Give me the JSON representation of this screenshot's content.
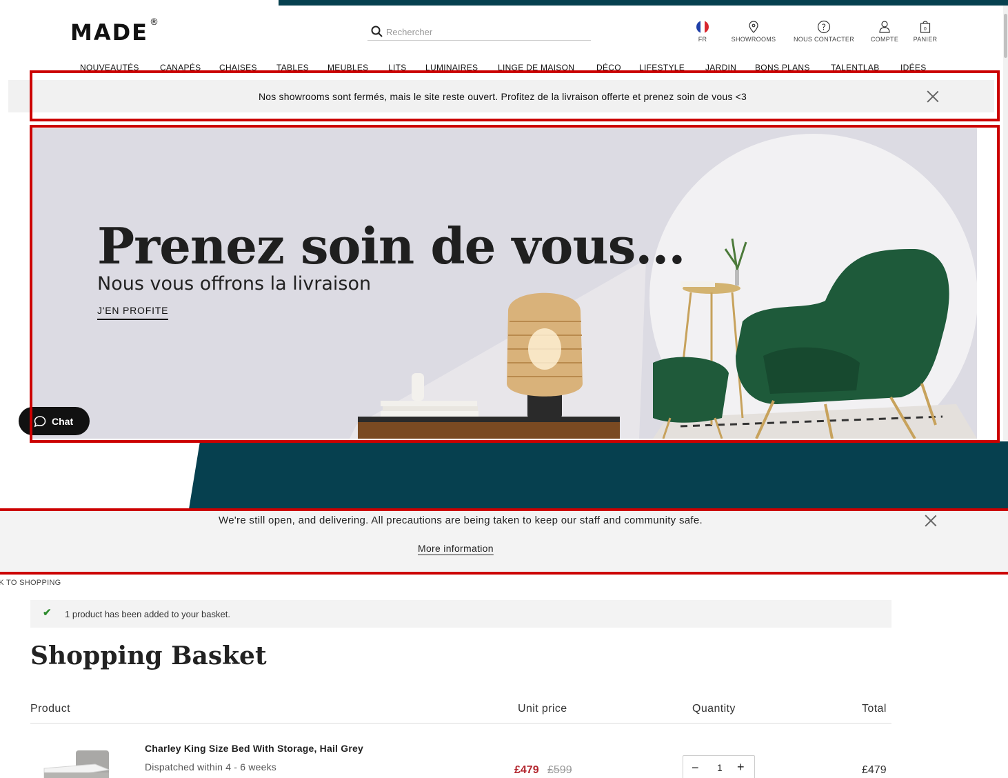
{
  "header": {
    "logo": "MADE",
    "logo_mark": "®",
    "search_placeholder": "Rechercher",
    "utils": [
      {
        "icon": "france-flag-icon",
        "label": "FR"
      },
      {
        "icon": "location-pin-icon",
        "label": "SHOWROOMS"
      },
      {
        "icon": "help-circle-icon",
        "label": "NOUS CONTACTER"
      },
      {
        "icon": "user-icon",
        "label": "COMPTE"
      },
      {
        "icon": "basket-icon",
        "label": "PANIER",
        "count": "0"
      }
    ],
    "nav": [
      "NOUVEAUTÉS",
      "CANAPÉS",
      "CHAISES",
      "TABLES",
      "MEUBLES",
      "LITS",
      "LUMINAIRES",
      "LINGE DE MAISON",
      "DÉCO",
      "LIFESTYLE",
      "JARDIN",
      "BONS PLANS",
      "TALENTLAB",
      "IDÉES"
    ]
  },
  "fr_banner": {
    "text": "Nos showrooms sont fermés, mais le site reste ouvert. Profitez de la livraison offerte et prenez soin de vous <3"
  },
  "hero": {
    "title": "Prenez soin de vous...",
    "subtitle": "Nous vous offrons la livraison",
    "cta": "J'EN PROFITE"
  },
  "chat": {
    "label": "Chat"
  },
  "en_banner": {
    "text": "We're still open, and delivering. All precautions are being taken to keep our staff and community safe.",
    "link": "More information"
  },
  "basket": {
    "back_link": "CK TO SHOPPING",
    "added_message": "1 product has been added to your basket.",
    "title": "Shopping Basket",
    "columns": {
      "product": "Product",
      "unit_price": "Unit price",
      "quantity": "Quantity",
      "total": "Total"
    },
    "item": {
      "name": "Charley King Size Bed With Storage, Hail Grey",
      "dispatch": "Dispatched within 4 - 6 weeks",
      "price_now": "£479",
      "price_old": "£599",
      "quantity": "1",
      "total": "£479"
    }
  },
  "colors": {
    "teal": "#06404f",
    "annotation_red": "#cc0000",
    "sale_red": "#b3262e",
    "hero_bg": "#dcdbe3"
  }
}
